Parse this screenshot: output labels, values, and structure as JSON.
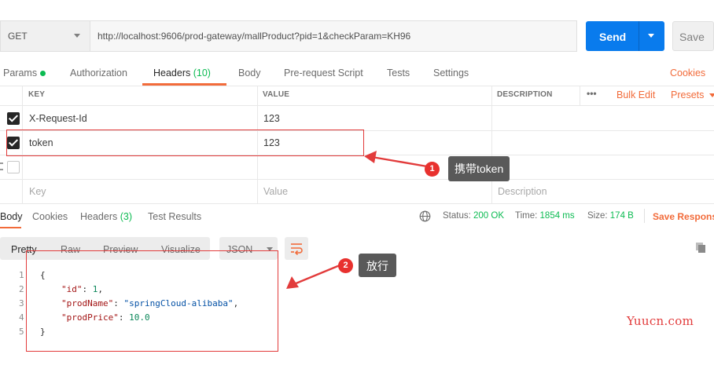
{
  "request": {
    "method": "GET",
    "url": "http://localhost:9606/prod-gateway/mallProduct?pid=1&checkParam=KH96",
    "send_label": "Send",
    "save_label": "Save"
  },
  "request_tabs": {
    "params": "Params",
    "authorization": "Authorization",
    "headers": "Headers",
    "headers_count": "(10)",
    "body": "Body",
    "prerequest": "Pre-request Script",
    "tests": "Tests",
    "settings": "Settings",
    "cookies": "Cookies"
  },
  "headers_table": {
    "col_key": "KEY",
    "col_value": "VALUE",
    "col_description": "DESCRIPTION",
    "more": "•••",
    "bulk_edit": "Bulk Edit",
    "presets": "Presets",
    "rows": [
      {
        "key": "X-Request-Id",
        "value": "123",
        "checked": true
      },
      {
        "key": "token",
        "value": "123",
        "checked": true
      }
    ],
    "placeholder": {
      "key": "Key",
      "value": "Value",
      "description": "Description"
    }
  },
  "response_tabs": {
    "body": "Body",
    "cookies": "Cookies",
    "headers": "Headers",
    "headers_count": "(3)",
    "test_results": "Test Results",
    "status_label": "Status:",
    "status_value": "200 OK",
    "time_label": "Time:",
    "time_value": "1854 ms",
    "size_label": "Size:",
    "size_value": "174 B",
    "save_response": "Save Respons"
  },
  "response_toolbar": {
    "pretty": "Pretty",
    "raw": "Raw",
    "preview": "Preview",
    "visualize": "Visualize",
    "format": "JSON"
  },
  "code": {
    "line_numbers": [
      "1",
      "2",
      "3",
      "4",
      "5"
    ],
    "open_brace": "{",
    "close_brace": "}",
    "id_key": "\"id\"",
    "id_val": "1",
    "name_key": "\"prodName\"",
    "name_val": "\"springCloud-alibaba\"",
    "price_key": "\"prodPrice\"",
    "price_val": "10.0"
  },
  "annotations": {
    "badge1": "1",
    "callout1": "携带token",
    "badge2": "2",
    "callout2": "放行",
    "color": "#e23b3b"
  },
  "watermark": "Yuucn.com"
}
